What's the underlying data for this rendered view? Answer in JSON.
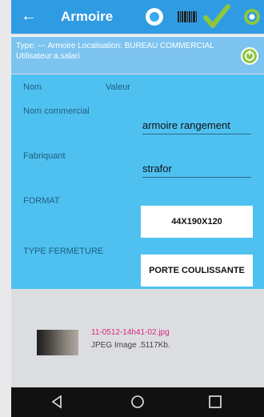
{
  "header": {
    "back_icon": "arrow-left-icon",
    "title": "Armoire",
    "actions": [
      {
        "icon": "compass-icon"
      },
      {
        "icon": "barcode-icon"
      },
      {
        "icon": "checkmark-icon"
      },
      {
        "icon": "lifebuoy-icon"
      }
    ]
  },
  "info": {
    "text": "Type: --- Armoire Localisation: BUREAU COMMERCIAL Utilisateur:a.salari",
    "button_icon": "refresh-icon"
  },
  "form": {
    "col_name": "Nom",
    "col_value": "Valeur",
    "rows": [
      {
        "label": "Nom commercial",
        "value": "armoire rangement"
      },
      {
        "label": "Fabriquant",
        "value": "strafor"
      },
      {
        "label": "FORMAT",
        "value": "44X190X120"
      },
      {
        "label": "TYPE FERMETURE",
        "value": "PORTE COULISSANTE"
      }
    ]
  },
  "attachment": {
    "filename": "11-0512-14h41-02.jpg",
    "meta": "JPEG Image .5117Kb."
  },
  "colors": {
    "appbar": "#2f9be3",
    "infobar": "#7cc4ef",
    "form": "#4fc1f0",
    "check": "#8dc63f",
    "filename": "#d9287f"
  }
}
